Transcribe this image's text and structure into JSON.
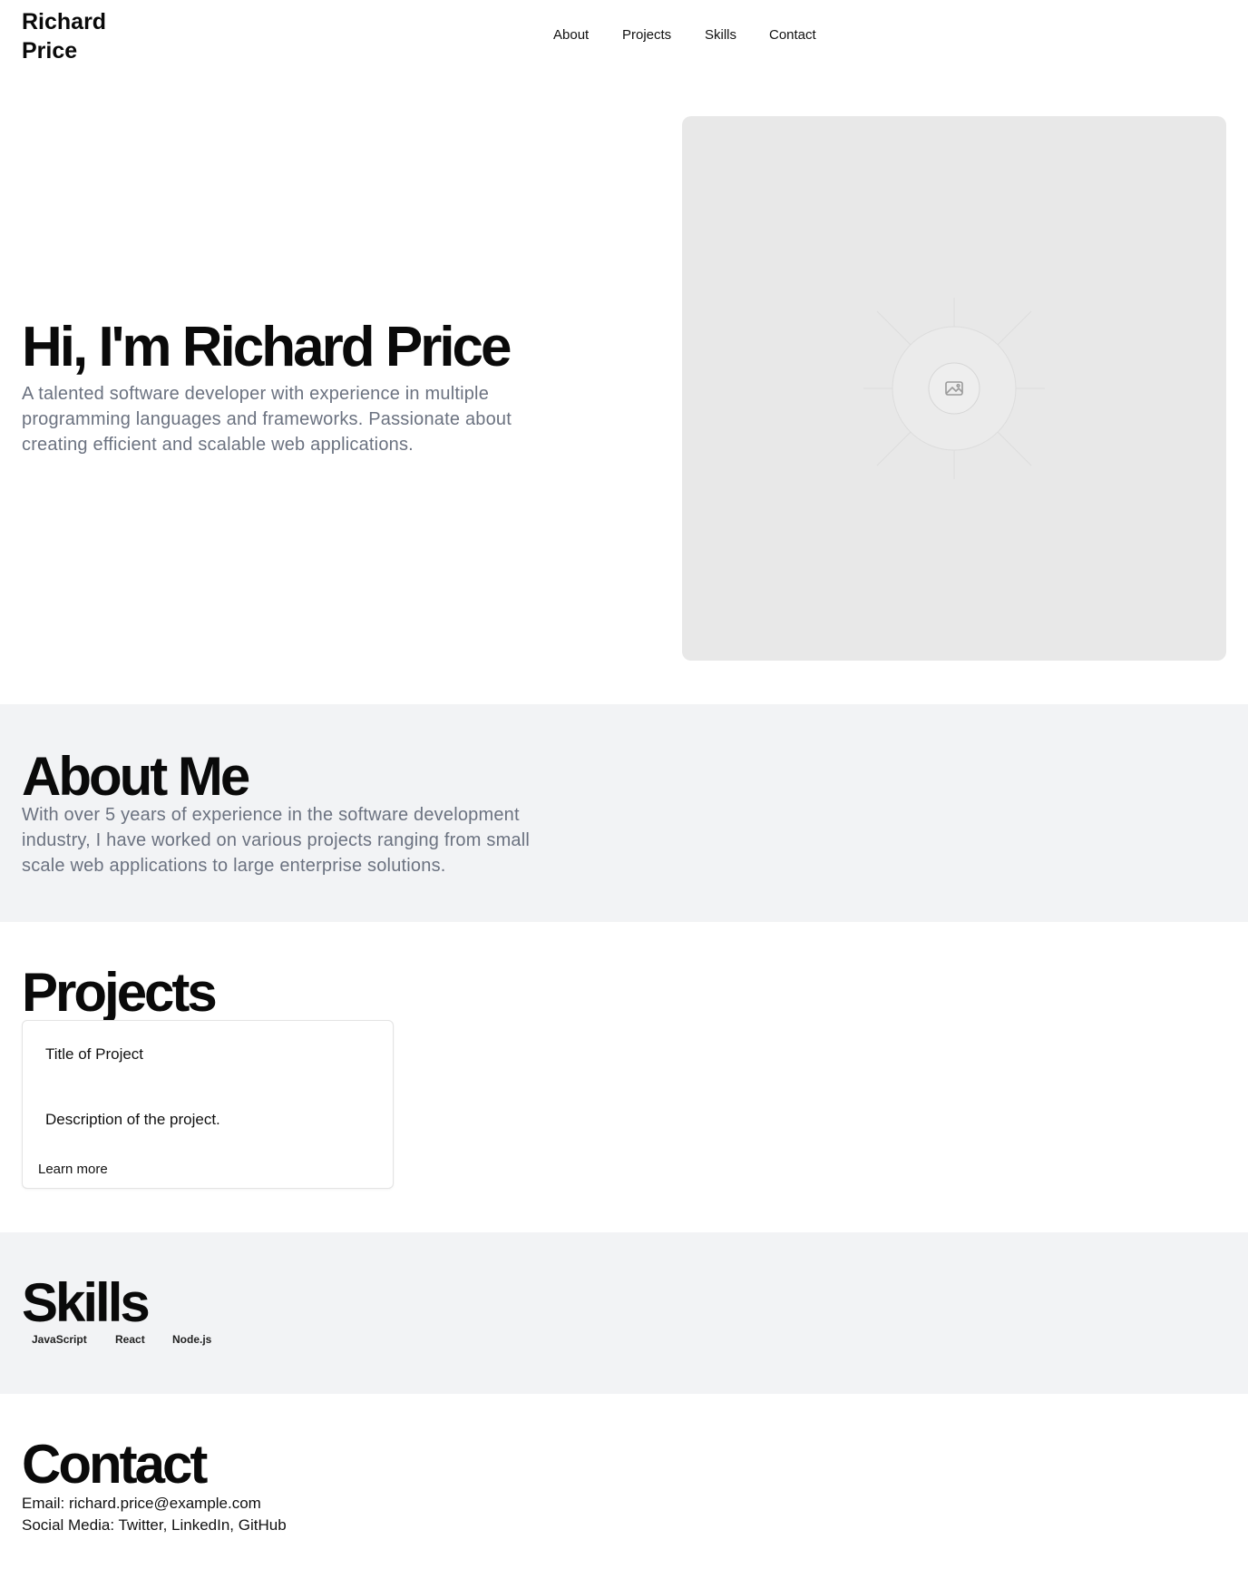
{
  "header": {
    "brand": "Richard Price",
    "nav": [
      "About",
      "Projects",
      "Skills",
      "Contact"
    ]
  },
  "hero": {
    "title": "Hi, I'm Richard Price",
    "subtitle": "A talented software developer with experience in multiple programming languages and frameworks. Passionate about creating efficient and scalable web applications.",
    "image_icon": "image-placeholder-icon"
  },
  "about": {
    "title": "About Me",
    "text": "With over 5 years of experience in the software development industry, I have worked on various projects ranging from small scale web applications to large enterprise solutions."
  },
  "projects": {
    "title": "Projects",
    "items": [
      {
        "title": "Title of Project",
        "description": "Description of the project.",
        "link": "Learn more"
      }
    ]
  },
  "skills": {
    "title": "Skills",
    "items": [
      "JavaScript",
      "React",
      "Node.js"
    ]
  },
  "contact": {
    "title": "Contact",
    "email_line": "Email: richard.price@example.com",
    "social_line": "Social Media: Twitter, LinkedIn, GitHub"
  },
  "colors": {
    "section_bg": "#f2f3f5",
    "muted_text": "#6b7280",
    "placeholder_bg": "#e8e8e8"
  }
}
